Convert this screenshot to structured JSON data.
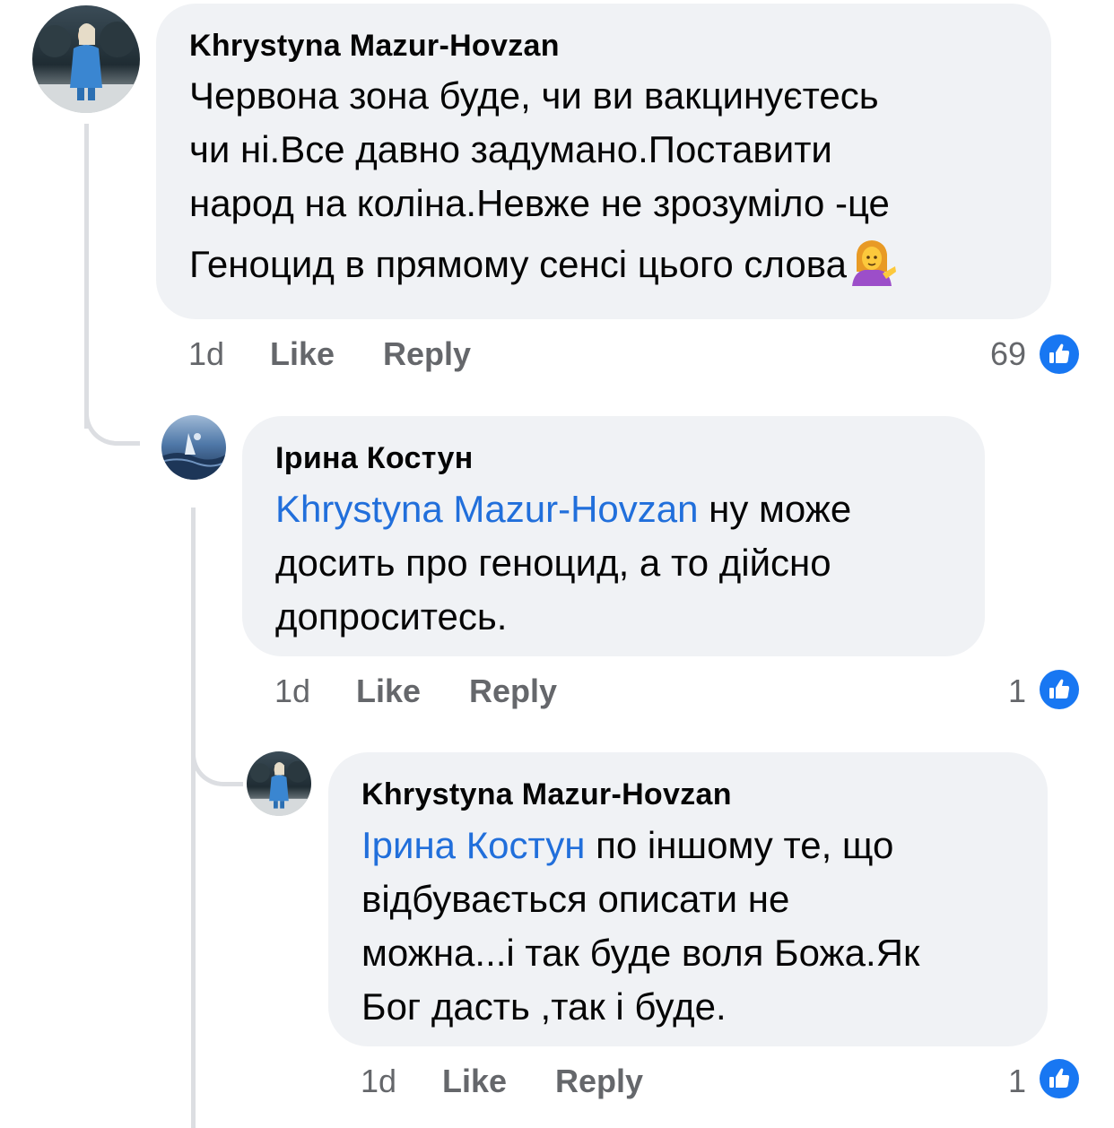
{
  "colors": {
    "bubble": "#f0f2f5",
    "mention": "#216fdb",
    "meta": "#65676b",
    "like_blue": "#1877f2",
    "thread_line": "#dcdee2"
  },
  "comments": [
    {
      "author": "Khrystyna Mazur-Hovzan",
      "avatar_icon": "profile-photo-woman-blue-coat",
      "mention": "",
      "lines": [
        "Червона зона буде, чи ви вакцинуєтесь",
        "чи ні.Все давно задумано.Поставити",
        "народ на коліна.Невже не зрозуміло -це",
        "Геноцид в прямому сенсі цього слова"
      ],
      "emoji": "person-tipping-hand-emoji",
      "time": "1d",
      "like_label": "Like",
      "reply_label": "Reply",
      "reactions": "69",
      "reaction_icon": "like-icon"
    },
    {
      "author": "Ірина Костун",
      "avatar_icon": "profile-photo-seascape",
      "mention": "Khrystyna Mazur-Hovzan",
      "lines": [
        " ну може",
        "досить про геноцид, а то дійсно",
        "допроситесь."
      ],
      "time": "1d",
      "like_label": "Like",
      "reply_label": "Reply",
      "reactions": "1",
      "reaction_icon": "like-icon"
    },
    {
      "author": "Khrystyna Mazur-Hovzan",
      "avatar_icon": "profile-photo-woman-blue-coat",
      "mention": "Ірина Костун",
      "lines": [
        " по іншому те, що",
        "відбувається описати не",
        "можна...і так буде воля Божа.Як",
        "Бог дасть ,так і буде."
      ],
      "time": "1d",
      "like_label": "Like",
      "reply_label": "Reply",
      "reactions": "1",
      "reaction_icon": "like-icon"
    }
  ]
}
